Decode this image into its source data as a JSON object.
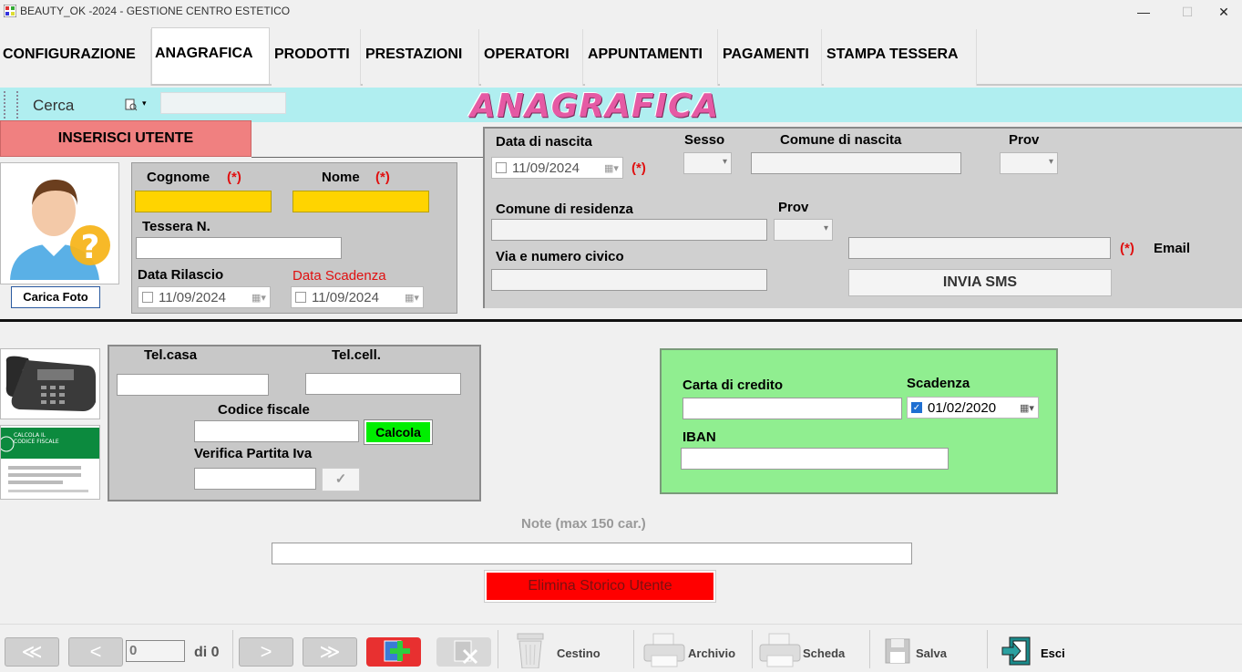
{
  "window": {
    "title": "BEAUTY_OK  -2024 -   GESTIONE CENTRO ESTETICO",
    "minimize": "—",
    "maximize": "☐",
    "close": "✕"
  },
  "tabs": [
    {
      "label": "CONFIGURAZIONE"
    },
    {
      "label": "ANAGRAFICA"
    },
    {
      "label": "PRODOTTI"
    },
    {
      "label": "PRESTAZIONI"
    },
    {
      "label": "OPERATORI"
    },
    {
      "label": "APPUNTAMENTI"
    },
    {
      "label": "PAGAMENTI"
    },
    {
      "label": "STAMPA TESSERA"
    }
  ],
  "toolbar": {
    "search_label": "Cerca",
    "search_value": "",
    "banner_title": "ANAGRAFICA"
  },
  "actions": {
    "insert_user": "INSERISCI  UTENTE",
    "upload_photo": "Carica Foto",
    "send_sms": "INVIA  SMS",
    "calcola": "Calcola",
    "delete_history": "Elimina Storico Utente",
    "verify_check": "✓"
  },
  "personal": {
    "surname_label": "Cognome",
    "name_label": "Nome",
    "required": "(*)",
    "card_number_label": "Tessera N.",
    "issue_date_label": "Data Rilascio",
    "issue_date": "11/09/2024",
    "expiry_date_label": "Data Scadenza",
    "expiry_date": "11/09/2024"
  },
  "birth": {
    "dob_label": "Data di nascita",
    "dob": "11/09/2024",
    "sex_label": "Sesso",
    "birthplace_label": "Comune di nascita",
    "prov_label": "Prov",
    "residence_label": "Comune di residenza",
    "res_prov_label": "Prov",
    "address_label": "Via e numero civico",
    "email_label": "Email"
  },
  "contacts": {
    "home_phone_label": "Tel.casa",
    "mobile_label": "Tel.cell.",
    "tax_code_label": "Codice fiscale",
    "vat_label": "Verifica Partita Iva",
    "tax_card_title": "CALCOLA IL CODICE FISCALE"
  },
  "payment": {
    "card_label": "Carta di credito",
    "expiry_label": "Scadenza",
    "expiry_value": "01/02/2020",
    "iban_label": "IBAN"
  },
  "notes": {
    "label": "Note (max 150 car.)"
  },
  "nav": {
    "record_value": "0",
    "of_label": "di 0",
    "first": "≪",
    "prev": "<",
    "next": ">",
    "last": "≫",
    "trash_label": "Cestino",
    "archive_label": "Archivio",
    "sheet_label": "Scheda",
    "save_label": "Salva",
    "exit_label": "Esci"
  },
  "colors": {
    "banner_bg": "#b0eef0",
    "banner_title": "#e55aa4",
    "insert_button": "#f08080",
    "required_field": "#ffd400",
    "delete_button": "#ff0000",
    "calcola_bg": "#00ee00",
    "payment_panel": "#90ee90"
  }
}
